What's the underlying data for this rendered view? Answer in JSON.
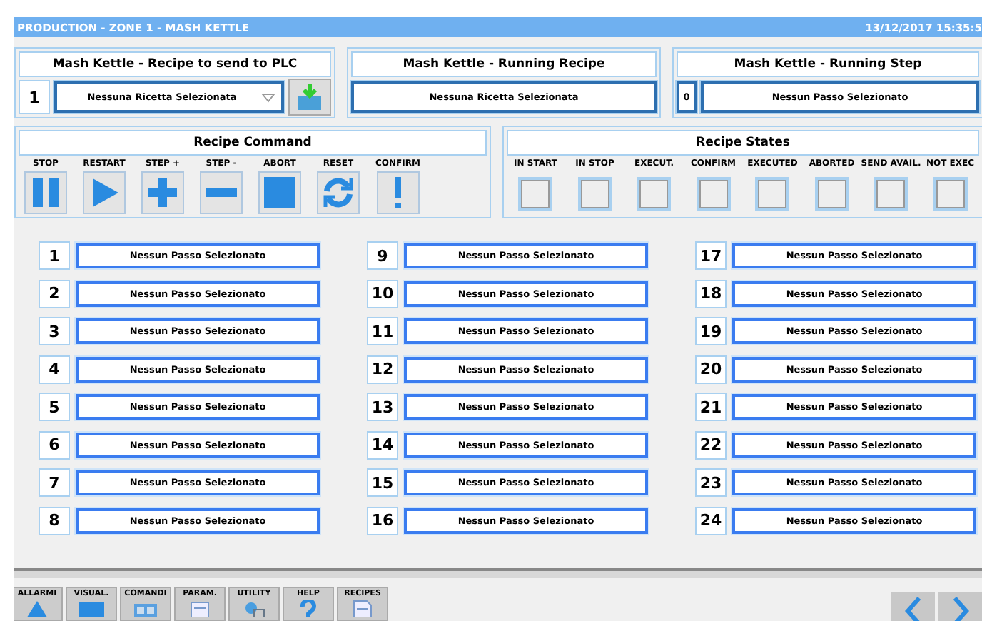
{
  "window": {
    "title": "PRODUCTION - ZONE 1 - MASH KETTLE",
    "datetime": "13/12/2017 15:35:5"
  },
  "recipe_to_send": {
    "title": "Mash Kettle - Recipe to send to PLC",
    "number": "1",
    "value": "Nessuna Ricetta Selezionata"
  },
  "running_recipe": {
    "title": "Mash Kettle - Running Recipe",
    "value": "Nessuna Ricetta Selezionata"
  },
  "running_step": {
    "title": "Mash Kettle - Running Step",
    "number": "0",
    "value": "Nessun Passo Selezionato"
  },
  "recipe_command": {
    "title": "Recipe Command",
    "buttons": [
      {
        "label": "STOP",
        "kind": "pause"
      },
      {
        "label": "RESTART",
        "kind": "play"
      },
      {
        "label": "STEP +",
        "kind": "plus"
      },
      {
        "label": "STEP -",
        "kind": "minus"
      },
      {
        "label": "ABORT",
        "kind": "square"
      },
      {
        "label": "RESET",
        "kind": "refresh"
      },
      {
        "label": "CONFIRM",
        "kind": "exclamation"
      }
    ]
  },
  "recipe_states": {
    "title": "Recipe States",
    "states": [
      {
        "label": "IN START",
        "checked": false
      },
      {
        "label": "IN STOP",
        "checked": false
      },
      {
        "label": "EXECUT.",
        "checked": false
      },
      {
        "label": "CONFIRM",
        "checked": false
      },
      {
        "label": "EXECUTED",
        "checked": false
      },
      {
        "label": "ABORTED",
        "checked": false
      },
      {
        "label": "SEND AVAIL.",
        "checked": false
      },
      {
        "label": "NOT EXEC",
        "checked": false
      }
    ]
  },
  "steps": [
    {
      "number": "1",
      "value": "Nessun Passo Selezionato"
    },
    {
      "number": "2",
      "value": "Nessun Passo Selezionato"
    },
    {
      "number": "3",
      "value": "Nessun Passo Selezionato"
    },
    {
      "number": "4",
      "value": "Nessun Passo Selezionato"
    },
    {
      "number": "5",
      "value": "Nessun Passo Selezionato"
    },
    {
      "number": "6",
      "value": "Nessun Passo Selezionato"
    },
    {
      "number": "7",
      "value": "Nessun Passo Selezionato"
    },
    {
      "number": "8",
      "value": "Nessun Passo Selezionato"
    },
    {
      "number": "9",
      "value": "Nessun Passo Selezionato"
    },
    {
      "number": "10",
      "value": "Nessun Passo Selezionato"
    },
    {
      "number": "11",
      "value": "Nessun Passo Selezionato"
    },
    {
      "number": "12",
      "value": "Nessun Passo Selezionato"
    },
    {
      "number": "13",
      "value": "Nessun Passo Selezionato"
    },
    {
      "number": "14",
      "value": "Nessun Passo Selezionato"
    },
    {
      "number": "15",
      "value": "Nessun Passo Selezionato"
    },
    {
      "number": "16",
      "value": "Nessun Passo Selezionato"
    },
    {
      "number": "17",
      "value": "Nessun Passo Selezionato"
    },
    {
      "number": "18",
      "value": "Nessun Passo Selezionato"
    },
    {
      "number": "19",
      "value": "Nessun Passo Selezionato"
    },
    {
      "number": "20",
      "value": "Nessun Passo Selezionato"
    },
    {
      "number": "21",
      "value": "Nessun Passo Selezionato"
    },
    {
      "number": "22",
      "value": "Nessun Passo Selezionato"
    },
    {
      "number": "23",
      "value": "Nessun Passo Selezionato"
    },
    {
      "number": "24",
      "value": "Nessun Passo Selezionato"
    }
  ],
  "taskbar": [
    {
      "label": "ALLARMI",
      "kind": "warning"
    },
    {
      "label": "VISUAL.",
      "kind": "monitor"
    },
    {
      "label": "COMANDI",
      "kind": "panel"
    },
    {
      "label": "PARAM.",
      "kind": "document"
    },
    {
      "label": "UTILITY",
      "kind": "tools"
    },
    {
      "label": "HELP",
      "kind": "help"
    },
    {
      "label": "RECIPES",
      "kind": "recipe"
    }
  ]
}
